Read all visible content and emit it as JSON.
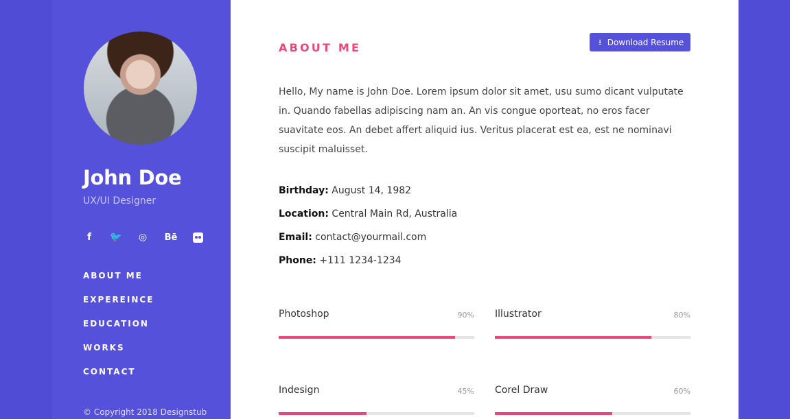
{
  "sidebar": {
    "name": "John Doe",
    "role": "UX/UI Designer",
    "social": [
      {
        "icon": "facebook-icon",
        "glyph": "f"
      },
      {
        "icon": "twitter-icon",
        "glyph": "🐦"
      },
      {
        "icon": "dribbble-icon",
        "glyph": "◎"
      },
      {
        "icon": "behance-icon",
        "glyph": "Bē"
      },
      {
        "icon": "flickr-icon",
        "glyph": ""
      }
    ],
    "nav": [
      "ABOUT ME",
      "EXPEREINCE",
      "EDUCATION",
      "WORKS",
      "CONTACT"
    ],
    "copyright": "© Copyright 2018 Designstub"
  },
  "main": {
    "title": "ABOUT ME",
    "download_label": "Download Resume",
    "bio": "Hello, My name is John Doe. Lorem ipsum dolor sit amet, usu sumo dicant vulputate in. Quando fabellas adipiscing nam an. An vis congue oporteat, no eros facer suavitate eos. An debet affert aliquid ius. Veritus placerat est ea, est ne nominavi suscipit maluisset.",
    "details": [
      {
        "label": "Birthday:",
        "value": "August 14, 1982"
      },
      {
        "label": "Location:",
        "value": "Central Main Rd, Australia"
      },
      {
        "label": "Email:",
        "value": "contact@yourmail.com"
      },
      {
        "label": "Phone:",
        "value": "+111 1234-1234"
      }
    ],
    "skills": [
      {
        "name": "Photoshop",
        "value": "90%",
        "level": 90
      },
      {
        "name": "Illustrator",
        "value": "80%",
        "level": 80
      },
      {
        "name": "Indesign",
        "value": "45%",
        "level": 45
      },
      {
        "name": "Corel Draw",
        "value": "60%",
        "level": 60
      }
    ]
  },
  "colors": {
    "primary": "#5651da",
    "accent": "#ec467a",
    "white": "#ffffff"
  }
}
